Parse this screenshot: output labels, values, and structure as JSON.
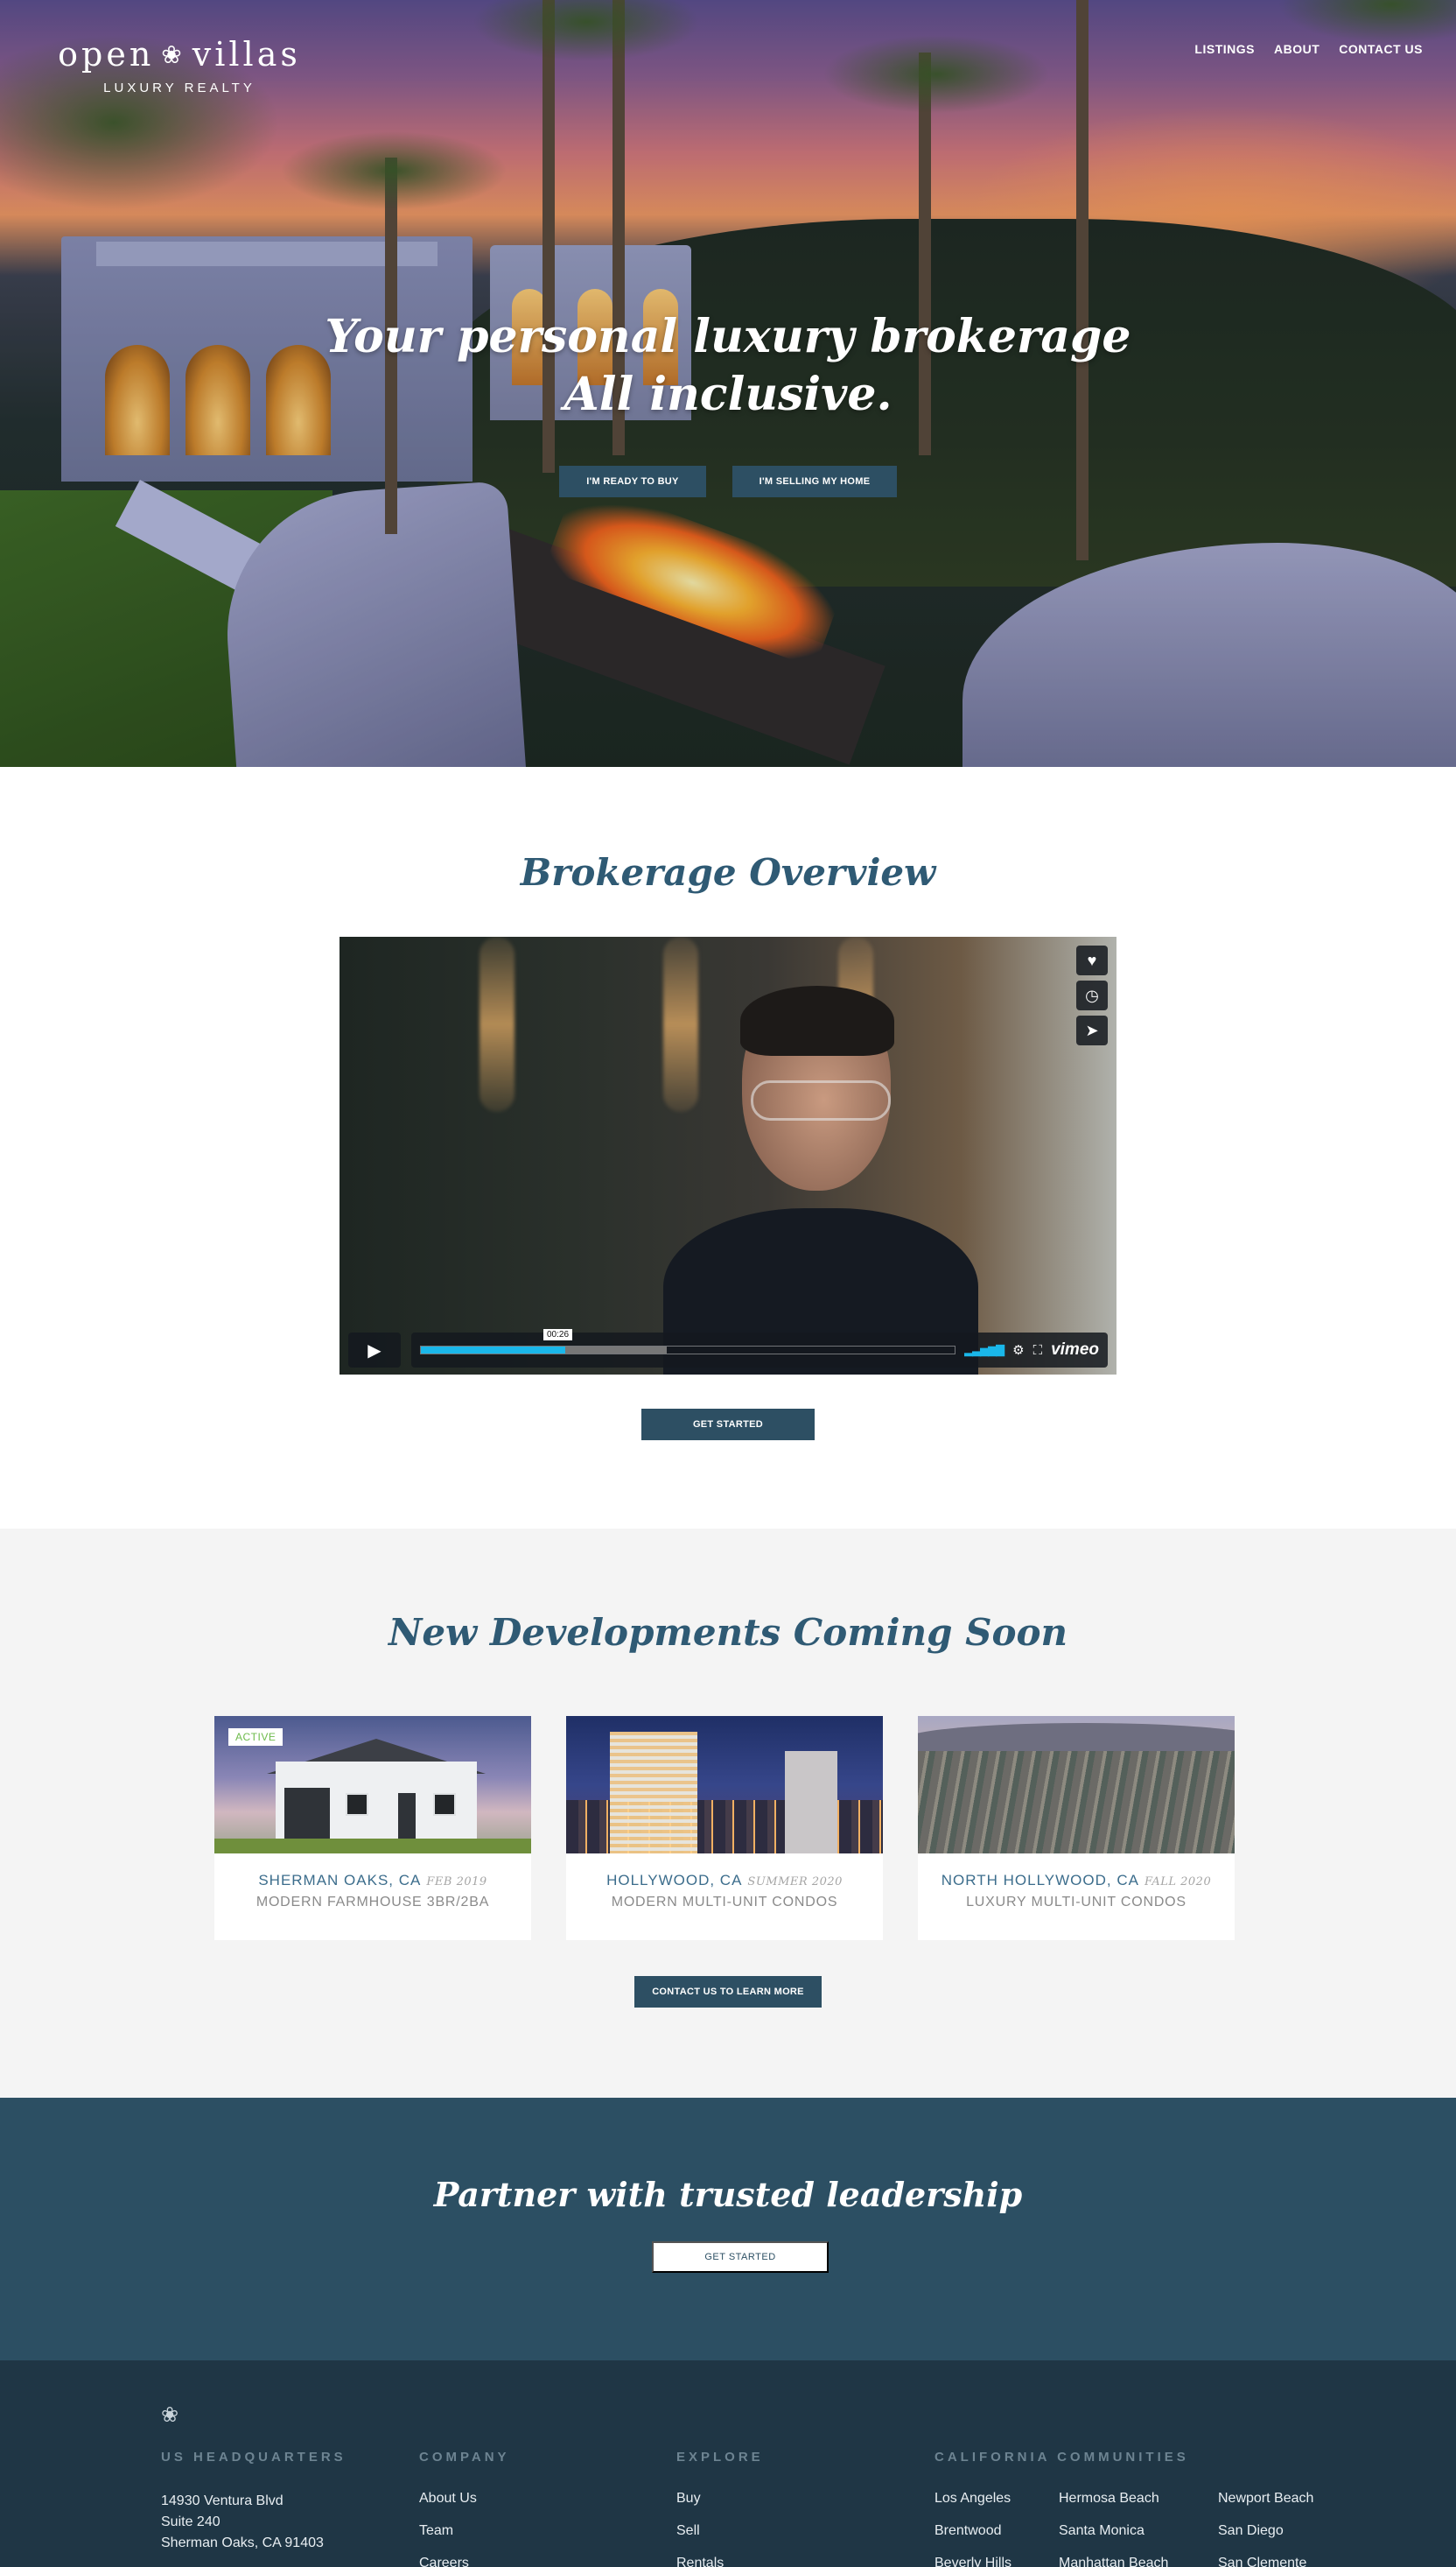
{
  "brand": {
    "name": "open villas",
    "tagline": "LUXURY REALTY",
    "emblem": "❀"
  },
  "nav": {
    "items": [
      "LISTINGS",
      "ABOUT",
      "CONTACT US"
    ]
  },
  "hero": {
    "headline_line1": "Your personal luxury brokerage",
    "headline_line2": "All inclusive.",
    "buy_button": "I'M READY TO BUY",
    "sell_button": "I'M SELLING MY HOME"
  },
  "overview": {
    "title": "Brokerage Overview",
    "video": {
      "timestamp": "00:26",
      "played_fraction": 0.27,
      "loaded_fraction": 0.46,
      "brand": "vimeo",
      "side_icons": [
        "heart-icon",
        "clock-icon",
        "send-icon"
      ]
    },
    "cta": "GET STARTED"
  },
  "developments": {
    "title": "New Developments Coming Soon",
    "cards": [
      {
        "location": "SHERMAN OAKS, CA",
        "date": "FEB 2019",
        "description": "MODERN FARMHOUSE 3BR/2BA",
        "badge": "ACTIVE"
      },
      {
        "location": "HOLLYWOOD, CA",
        "date": "SUMMER 2020",
        "description": "MODERN MULTI-UNIT CONDOS"
      },
      {
        "location": "NORTH HOLLYWOOD, CA",
        "date": "FALL 2020",
        "description": "LUXURY MULTI-UNIT CONDOS"
      }
    ],
    "cta": "CONTACT US TO LEARN MORE"
  },
  "partner": {
    "title": "Partner with trusted leadership",
    "cta": "GET STARTED"
  },
  "footer": {
    "hq": {
      "heading": "US HEADQUARTERS",
      "line1": "14930 Ventura Blvd",
      "line2": "Suite 240",
      "line3": "Sherman Oaks, CA 91403"
    },
    "company": {
      "heading": "COMPANY",
      "links": [
        "About Us",
        "Team",
        "Careers"
      ]
    },
    "explore": {
      "heading": "EXPLORE",
      "links": [
        "Buy",
        "Sell",
        "Rentals"
      ]
    },
    "communities": {
      "heading": "CALIFORNIA COMMUNITIES",
      "links": [
        "Los Angeles",
        "Hermosa Beach",
        "Newport Beach",
        "Brentwood",
        "Santa Monica",
        "San Diego",
        "Beverly Hills",
        "Manhattan Beach",
        "San Clemente"
      ]
    }
  },
  "colors": {
    "primary": "#2c4f63",
    "heading": "#2f5a74",
    "footer_bg": "#1f3645",
    "active_badge": "#6dbb4b",
    "vimeo_blue": "#1ab7ea"
  }
}
